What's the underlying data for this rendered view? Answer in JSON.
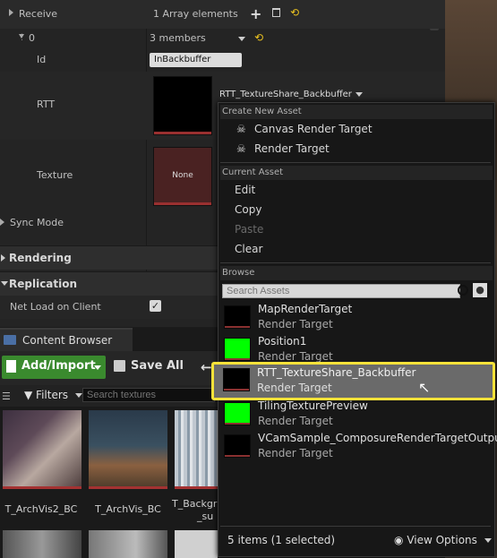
{
  "details": {
    "receive_label": "Receive",
    "receive_value": "1 Array elements",
    "index_label": "0",
    "members_value": "3 members",
    "id_label": "Id",
    "id_value": "InBackbuffer",
    "rtt_label": "RTT",
    "rtt_combo": "RTT_TextureShare_Backbuffer",
    "texture_label": "Texture",
    "texture_thumb_text": "None",
    "sync_mode_label": "Sync Mode",
    "rendering_label": "Rendering",
    "replication_label": "Replication",
    "net_load_label": "Net Load on Client"
  },
  "content_browser": {
    "tab_title": "Content Browser",
    "add_import_label": "Add/Import",
    "save_all_label": "Save All",
    "filters_label": "Filters",
    "search_placeholder": "Search textures",
    "tiles": [
      {
        "label": "T_ArchVis2_BC"
      },
      {
        "label": "T_ArchVis_BC"
      },
      {
        "label": "T_Backgr",
        "label2": "_su"
      }
    ]
  },
  "menu": {
    "create_header": "Create New Asset",
    "create_items": [
      "Canvas Render Target",
      "Render Target"
    ],
    "current_header": "Current Asset",
    "current_items": [
      "Edit",
      "Copy",
      "Paste",
      "Clear"
    ],
    "browse_header": "Browse",
    "search_placeholder": "Search Assets",
    "assets": [
      {
        "name": "MapRenderTarget",
        "type": "Render Target",
        "color": "#000000"
      },
      {
        "name": "Position1",
        "type": "Render Target",
        "color": "#00ff00"
      },
      {
        "name": "RTT_TextureShare_Backbuffer",
        "type": "Render Target",
        "color": "#000000"
      },
      {
        "name": "TilingTexturePreview",
        "type": "Render Target",
        "color": "#00ff00"
      },
      {
        "name": "VCamSample_ComposureRenderTargetOutput",
        "type": "Render Target",
        "color": "#000000"
      }
    ],
    "status": "5 items (1 selected)",
    "view_options": "View Options"
  },
  "colors": {
    "highlight": "#f5e23a",
    "accent_green": "#3a8a2e"
  }
}
